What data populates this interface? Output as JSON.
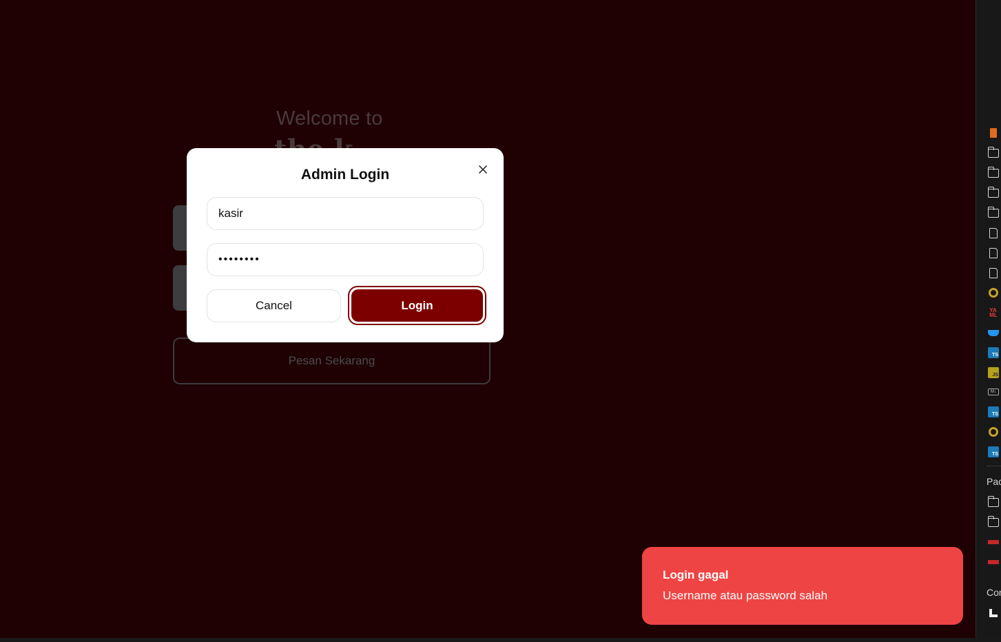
{
  "background": {
    "welcome_text": "Welcome to",
    "order_button_label": "Pesan Sekarang"
  },
  "modal": {
    "title": "Admin Login",
    "username_value": "kasir",
    "password_value": "••••••••",
    "cancel_label": "Cancel",
    "login_label": "Login"
  },
  "toast": {
    "title": "Login gagal",
    "message": "Username atau password salah",
    "color": "#ef4444"
  },
  "sidebar": {
    "section_packages": "Pac",
    "section_con": "Con",
    "icons": [
      "html-icon",
      "folder-icon",
      "folder-icon",
      "folder-icon",
      "folder-icon",
      "file-icon",
      "file-icon",
      "file-icon",
      "ring-icon",
      "yaml-icon",
      "docker-icon",
      "ts-icon",
      "js-icon",
      "markdown-icon",
      "ts-icon",
      "ring-icon",
      "ts-icon",
      "folder-icon",
      "folder-icon",
      "npm-icon",
      "npm-icon",
      "graph-icon"
    ]
  },
  "colors": {
    "page_background": "#1f0003",
    "accent": "#7d0000"
  }
}
